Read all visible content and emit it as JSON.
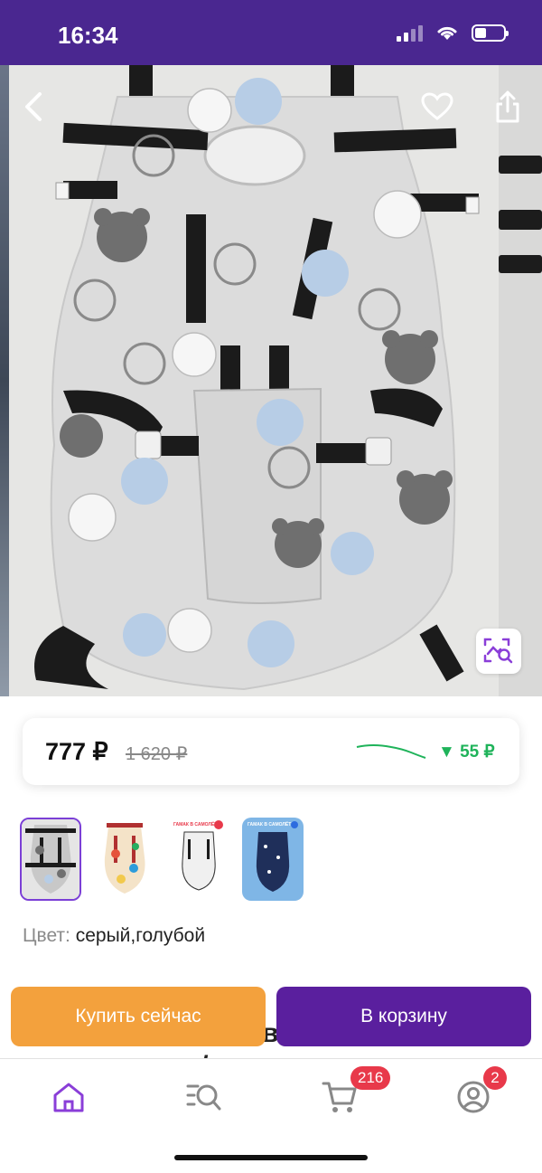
{
  "status_bar": {
    "time": "16:34"
  },
  "gallery": {
    "back_icon": "chevron-left-icon",
    "favorite_icon": "heart-icon",
    "share_icon": "share-icon",
    "image_search_icon": "image-search-icon"
  },
  "price": {
    "current": "777 ₽",
    "old": "1 620 ₽",
    "drop": "▼ 55 ₽",
    "trend_color": "#1fb35a"
  },
  "variants": [
    {
      "name": "серый,голубой",
      "selected": true
    },
    {
      "name": "variant-2",
      "selected": false
    },
    {
      "name": "variant-3",
      "selected": false
    },
    {
      "name": "variant-4",
      "selected": false
    }
  ],
  "thumb_texts": {
    "t3_top": "ГАМАК В САМОЛЁТ",
    "t4_top": "ГАМАК В САМОЛЁТ"
  },
  "color": {
    "label": "Цвет:",
    "value": "серый,голубой"
  },
  "title_partial": {
    "line1": "в",
    "line2": "для малыша / люлька в"
  },
  "actions": {
    "buy_now": "Купить сейчас",
    "add_to_cart": "В корзину"
  },
  "tabbar": {
    "home_icon": "home-icon",
    "catalog_icon": "catalog-search-icon",
    "cart_icon": "cart-icon",
    "cart_badge": "216",
    "profile_icon": "profile-icon",
    "profile_badge": "2",
    "active_color": "#8a3ed8"
  },
  "colors": {
    "brand": "#4a2790",
    "buy": "#f3a13d",
    "cart": "#5a1f9e",
    "badge": "#e8394a"
  }
}
